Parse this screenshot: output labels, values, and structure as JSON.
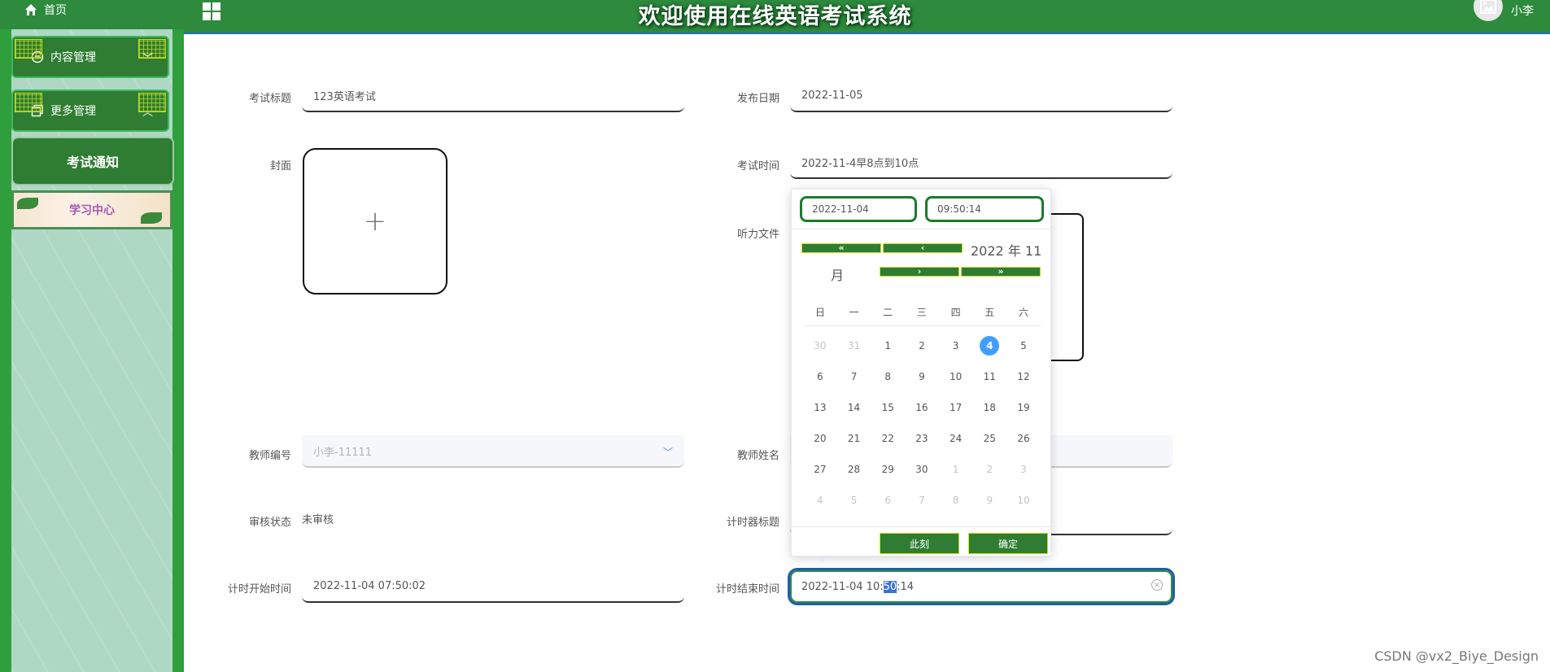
{
  "header": {
    "home_label": "首页",
    "title": "欢迎使用在线英语考试系统",
    "username": "小李"
  },
  "sidebar": {
    "menu1": "内容管理",
    "menu2": "更多管理",
    "active_item": "考试通知",
    "banner": "学习中心"
  },
  "form": {
    "exam_title_label": "考试标题",
    "exam_title_value": "123英语考试",
    "publish_date_label": "发布日期",
    "publish_date_value": "2022-11-05",
    "cover_label": "封面",
    "exam_time_label": "考试时间",
    "exam_time_value": "2022-11-4早8点到10点",
    "audio_label": "听力文件",
    "teacher_id_label": "教师编号",
    "teacher_id_value": "小李-11111",
    "teacher_name_label": "教师姓名",
    "review_label": "审核状态",
    "review_value": "未审核",
    "timer_title_label": "计时器标题",
    "start_time_label": "计时开始时间",
    "start_time_value": "2022-11-04 07:50:02",
    "end_time_label": "计时结束时间",
    "end_time_value_a": "2022-11-04 10:",
    "end_time_value_b": "50",
    "end_time_value_c": ":14"
  },
  "picker": {
    "date_value": "2022-11-04",
    "time_value": "09:50:14",
    "year_text": "2022 年  11",
    "month_text": "月",
    "weekdays": [
      "日",
      "一",
      "二",
      "三",
      "四",
      "五",
      "六"
    ],
    "days": [
      {
        "d": "30",
        "dim": true
      },
      {
        "d": "31",
        "dim": true
      },
      {
        "d": "1"
      },
      {
        "d": "2"
      },
      {
        "d": "3"
      },
      {
        "d": "4",
        "sel": true
      },
      {
        "d": "5"
      },
      {
        "d": "6"
      },
      {
        "d": "7"
      },
      {
        "d": "8"
      },
      {
        "d": "9"
      },
      {
        "d": "10"
      },
      {
        "d": "11"
      },
      {
        "d": "12"
      },
      {
        "d": "13"
      },
      {
        "d": "14"
      },
      {
        "d": "15"
      },
      {
        "d": "16"
      },
      {
        "d": "17"
      },
      {
        "d": "18"
      },
      {
        "d": "19"
      },
      {
        "d": "20"
      },
      {
        "d": "21"
      },
      {
        "d": "22"
      },
      {
        "d": "23"
      },
      {
        "d": "24"
      },
      {
        "d": "25"
      },
      {
        "d": "26"
      },
      {
        "d": "27"
      },
      {
        "d": "28"
      },
      {
        "d": "29"
      },
      {
        "d": "30"
      },
      {
        "d": "1",
        "dim": true
      },
      {
        "d": "2",
        "dim": true
      },
      {
        "d": "3",
        "dim": true
      },
      {
        "d": "4",
        "dim": true
      },
      {
        "d": "5",
        "dim": true
      },
      {
        "d": "6",
        "dim": true
      },
      {
        "d": "7",
        "dim": true
      },
      {
        "d": "8",
        "dim": true
      },
      {
        "d": "9",
        "dim": true
      },
      {
        "d": "10",
        "dim": true
      }
    ],
    "now_label": "此刻",
    "confirm_label": "确定",
    "prev_year": "«",
    "prev_month": "‹",
    "next_month": "›",
    "next_year": "»"
  },
  "watermark": "CSDN @vx2_Biye_Design",
  "colors": {
    "header": "#2e8b3e",
    "accent": "#409eff",
    "sidebar": "#aed8c4"
  }
}
